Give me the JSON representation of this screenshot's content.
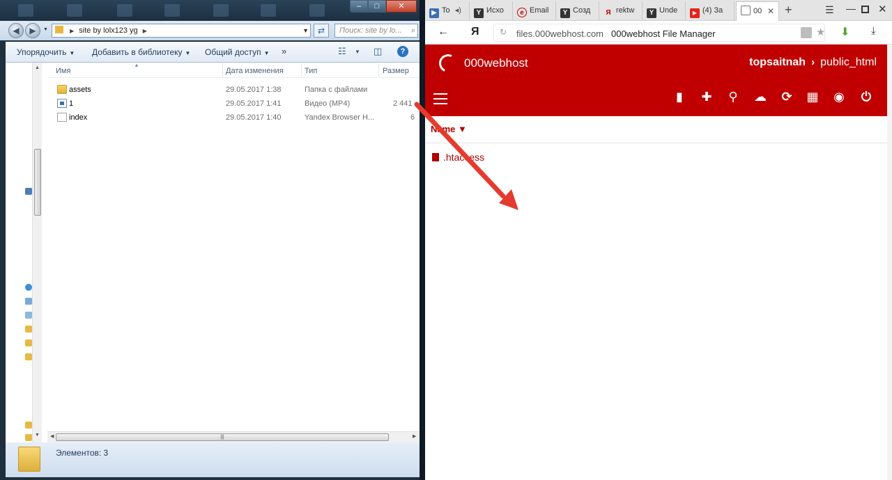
{
  "explorer": {
    "address": {
      "segments": [
        "site by lolx123 yg"
      ]
    },
    "search_placeholder": "Поиск: site by lo...",
    "toolbar": {
      "organize": "Упорядочить",
      "add_to_library": "Добавить в библиотеку",
      "share": "Общий доступ",
      "more": "»"
    },
    "columns": {
      "name": "Имя",
      "date": "Дата изменения",
      "type": "Тип",
      "size": "Размер"
    },
    "files": [
      {
        "name": "assets",
        "date": "29.05.2017 1:38",
        "type": "Папка с файлами",
        "size": "",
        "icon": "folder-icon"
      },
      {
        "name": "1",
        "date": "29.05.2017 1:41",
        "type": "Видео (MP4)",
        "size": "2 441",
        "icon": "video-file-icon"
      },
      {
        "name": "index",
        "date": "29.05.2017 1:40",
        "type": "Yandex Browser H...",
        "size": "6",
        "icon": "html-file-icon"
      }
    ],
    "status": "Элементов: 3"
  },
  "browser": {
    "tabs": [
      {
        "label": "To",
        "icon": "youtube-tab-icon",
        "color": "#3a6fb0"
      },
      {
        "label": "Исхо",
        "icon": "yandex-tab-icon",
        "color": "#333333"
      },
      {
        "label": "Email",
        "icon": "webhost-tab-icon",
        "color": "#c00000"
      },
      {
        "label": "Созд",
        "icon": "yandex-tab-icon",
        "color": "#333333"
      },
      {
        "label": "rektw",
        "icon": "yandex-search-tab-icon",
        "color": "#c00000"
      },
      {
        "label": "Unde",
        "icon": "yandex-tab-icon",
        "color": "#333333"
      },
      {
        "label": "(4) За",
        "icon": "youtube-tab-icon",
        "color": "#e62117"
      },
      {
        "label": "00",
        "icon": "page-tab-icon",
        "color": "#555555"
      }
    ],
    "url_host": "files.000webhost.com",
    "url_title": "000webhost File Manager",
    "logo_text": "Я"
  },
  "webhost": {
    "brand": "000webhost",
    "path_user": "topsaitnah",
    "path_dir": "public_html",
    "column_name": "Name ▼",
    "files": [
      {
        "name": ".htaccess"
      }
    ],
    "accent": "#c00000"
  }
}
